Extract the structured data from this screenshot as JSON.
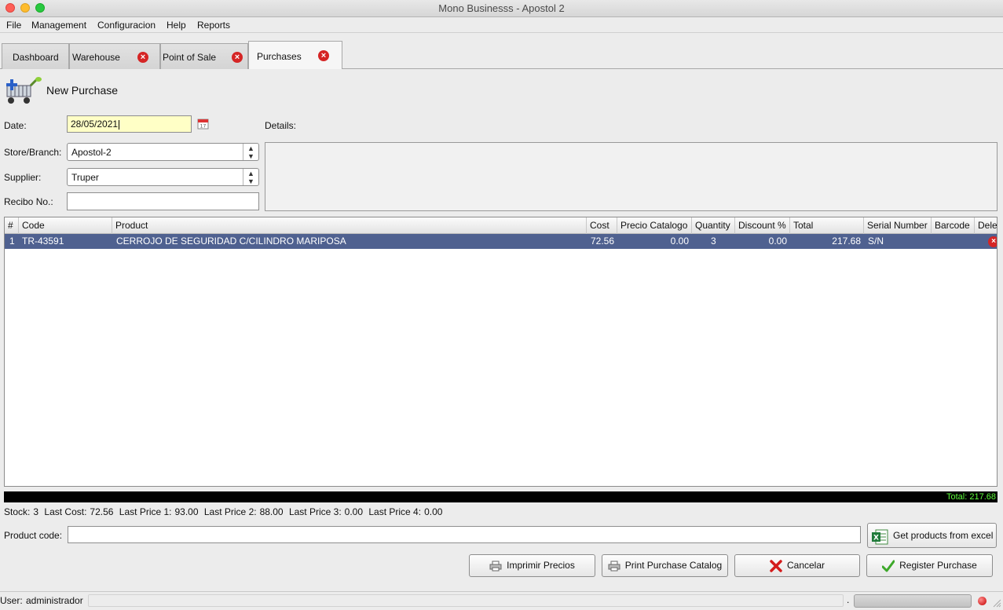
{
  "window": {
    "title": "Mono Businesss - Apostol 2"
  },
  "menu": [
    "File",
    "Management",
    "Configuracion",
    "Help",
    "Reports"
  ],
  "tabs": [
    {
      "label": "Dashboard",
      "closable": false,
      "active": false
    },
    {
      "label": "Warehouse",
      "closable": true,
      "active": false
    },
    {
      "label": "Point of Sale",
      "closable": true,
      "active": false
    },
    {
      "label": "Purchases",
      "closable": true,
      "active": true
    }
  ],
  "header": {
    "title": "New Purchase",
    "icon": "shopping-cart-add-icon"
  },
  "form": {
    "date_label": "Date:",
    "date_value": "28/05/2021",
    "details_label": "Details:",
    "store_label": "Store/Branch:",
    "store_value": "Apostol-2",
    "supplier_label": "Supplier:",
    "supplier_value": "Truper",
    "recibo_label": "Recibo No.:",
    "recibo_value": ""
  },
  "table": {
    "columns": [
      "#",
      "Code",
      "Product",
      "Cost",
      "Precio Catalogo",
      "Quantity",
      "Discount %",
      "Total",
      "Serial Number",
      "Barcode",
      "Dele"
    ],
    "rows": [
      {
        "num": "1",
        "code": "TR-43591",
        "product": "CERROJO DE SEGURIDAD C/CILINDRO MARIPOSA",
        "cost": "72.56",
        "precio_catalogo": "0.00",
        "quantity": "3",
        "discount": "0.00",
        "total": "217.68",
        "serial": "S/N",
        "barcode": ""
      }
    ]
  },
  "total_label": "Total: 217.68",
  "stock": {
    "stock_label": "Stock:",
    "stock_value": "3",
    "last_cost_label": "Last Cost:",
    "last_cost_value": "72.56",
    "lp1_label": "Last Price 1:",
    "lp1_value": "93.00",
    "lp2_label": "Last Price 2:",
    "lp2_value": "88.00",
    "lp3_label": "Last Price 3:",
    "lp3_value": "0.00",
    "lp4_label": "Last Price 4:",
    "lp4_value": "0.00"
  },
  "product_code": {
    "label": "Product code:",
    "value": ""
  },
  "buttons": {
    "excel": "Get products from excel",
    "imprimir": "Imprimir Precios",
    "print_catalog": "Print Purchase Catalog",
    "cancelar": "Cancelar",
    "register": "Register Purchase"
  },
  "status": {
    "user_label": "User:",
    "user_value": "administrador",
    "dot": "."
  },
  "colors": {
    "selection": "#4f6190",
    "total_text": "#5dfc3a",
    "close_red": "#d52525"
  }
}
